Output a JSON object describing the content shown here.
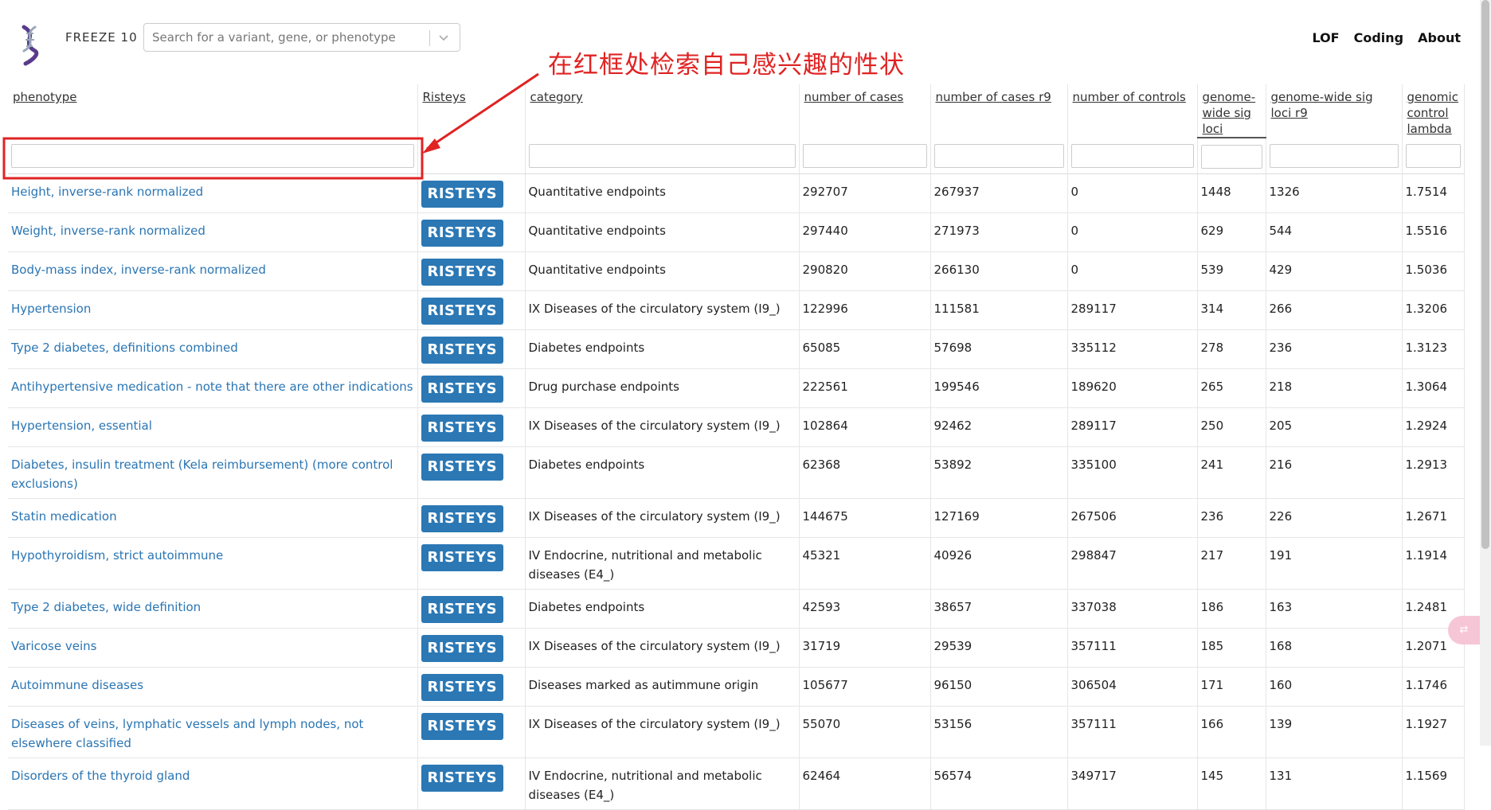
{
  "header": {
    "freeze_label": "FREEZE 10",
    "search_placeholder": "Search for a variant, gene, or phenotype",
    "nav": [
      "LOF",
      "Coding",
      "About"
    ]
  },
  "annotation": {
    "text": "在红框处检索自己感兴趣的性状",
    "color": "#e02323"
  },
  "colors": {
    "link": "#2a75b3",
    "risteys_button": "#2b78b5"
  },
  "table": {
    "columns": [
      "phenotype",
      "Risteys",
      "category",
      "number of cases",
      "number of cases r9",
      "number of controls",
      "genome-wide sig loci",
      "genome-wide sig loci r9",
      "genomic control lambda"
    ],
    "button_label": "RISTEYS",
    "rows": [
      {
        "phenotype": "Height, inverse-rank normalized",
        "category": "Quantitative endpoints",
        "cases": "292707",
        "cases_r9": "267937",
        "controls": "0",
        "loci": "1448",
        "loci_r9": "1326",
        "lambda": "1.7514"
      },
      {
        "phenotype": "Weight, inverse-rank normalized",
        "category": "Quantitative endpoints",
        "cases": "297440",
        "cases_r9": "271973",
        "controls": "0",
        "loci": "629",
        "loci_r9": "544",
        "lambda": "1.5516"
      },
      {
        "phenotype": "Body-mass index, inverse-rank normalized",
        "category": "Quantitative endpoints",
        "cases": "290820",
        "cases_r9": "266130",
        "controls": "0",
        "loci": "539",
        "loci_r9": "429",
        "lambda": "1.5036"
      },
      {
        "phenotype": "Hypertension",
        "category": "IX Diseases of the circulatory system (I9_)",
        "cases": "122996",
        "cases_r9": "111581",
        "controls": "289117",
        "loci": "314",
        "loci_r9": "266",
        "lambda": "1.3206"
      },
      {
        "phenotype": "Type 2 diabetes, definitions combined",
        "category": "Diabetes endpoints",
        "cases": "65085",
        "cases_r9": "57698",
        "controls": "335112",
        "loci": "278",
        "loci_r9": "236",
        "lambda": "1.3123"
      },
      {
        "phenotype": "Antihypertensive medication - note that there are other indications",
        "category": "Drug purchase endpoints",
        "cases": "222561",
        "cases_r9": "199546",
        "controls": "189620",
        "loci": "265",
        "loci_r9": "218",
        "lambda": "1.3064"
      },
      {
        "phenotype": "Hypertension, essential",
        "category": "IX Diseases of the circulatory system (I9_)",
        "cases": "102864",
        "cases_r9": "92462",
        "controls": "289117",
        "loci": "250",
        "loci_r9": "205",
        "lambda": "1.2924"
      },
      {
        "phenotype": "Diabetes, insulin treatment (Kela reimbursement) (more control exclusions)",
        "category": "Diabetes endpoints",
        "cases": "62368",
        "cases_r9": "53892",
        "controls": "335100",
        "loci": "241",
        "loci_r9": "216",
        "lambda": "1.2913"
      },
      {
        "phenotype": "Statin medication",
        "category": "IX Diseases of the circulatory system (I9_)",
        "cases": "144675",
        "cases_r9": "127169",
        "controls": "267506",
        "loci": "236",
        "loci_r9": "226",
        "lambda": "1.2671"
      },
      {
        "phenotype": "Hypothyroidism, strict autoimmune",
        "category": "IV Endocrine, nutritional and metabolic diseases (E4_)",
        "cases": "45321",
        "cases_r9": "40926",
        "controls": "298847",
        "loci": "217",
        "loci_r9": "191",
        "lambda": "1.1914"
      },
      {
        "phenotype": "Type 2 diabetes, wide definition",
        "category": "Diabetes endpoints",
        "cases": "42593",
        "cases_r9": "38657",
        "controls": "337038",
        "loci": "186",
        "loci_r9": "163",
        "lambda": "1.2481"
      },
      {
        "phenotype": "Varicose veins",
        "category": "IX Diseases of the circulatory system (I9_)",
        "cases": "31719",
        "cases_r9": "29539",
        "controls": "357111",
        "loci": "185",
        "loci_r9": "168",
        "lambda": "1.2071"
      },
      {
        "phenotype": "Autoimmune diseases",
        "category": "Diseases marked as autimmune origin",
        "cases": "105677",
        "cases_r9": "96150",
        "controls": "306504",
        "loci": "171",
        "loci_r9": "160",
        "lambda": "1.1746"
      },
      {
        "phenotype": "Diseases of veins, lymphatic vessels and lymph nodes, not elsewhere classified",
        "category": "IX Diseases of the circulatory system (I9_)",
        "cases": "55070",
        "cases_r9": "53156",
        "controls": "357111",
        "loci": "166",
        "loci_r9": "139",
        "lambda": "1.1927"
      },
      {
        "phenotype": "Disorders of the thyroid gland",
        "category": "IV Endocrine, nutritional and metabolic diseases (E4_)",
        "cases": "62464",
        "cases_r9": "56574",
        "controls": "349717",
        "loci": "145",
        "loci_r9": "131",
        "lambda": "1.1569"
      }
    ]
  }
}
